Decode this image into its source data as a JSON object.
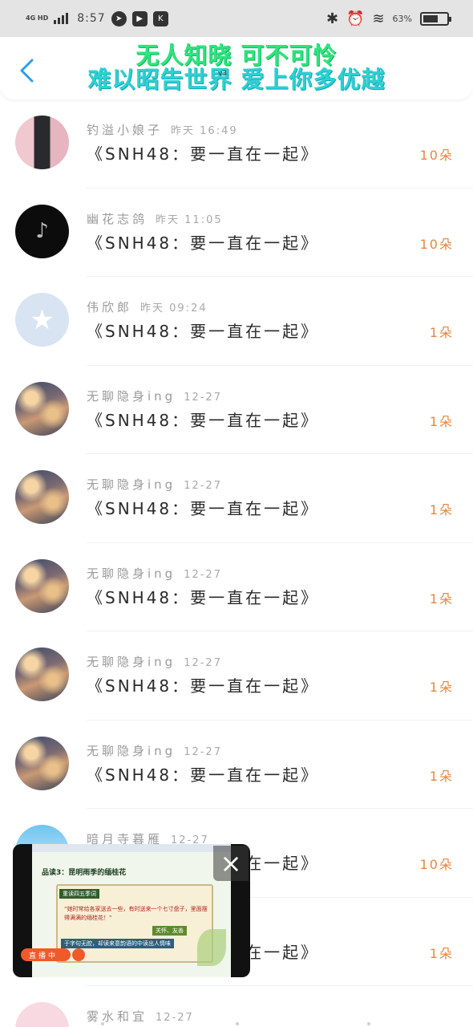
{
  "status_bar": {
    "network": "4G HD",
    "time": "8:57",
    "apps": [
      "telegram-icon",
      "play-icon",
      "k-app-icon"
    ],
    "battery_pct": "63%"
  },
  "nav": {
    "title_line1": "无人知晓 可不可怜",
    "title_line2": "难以昭告世界 爱上你多优越",
    "title_badge": "v3"
  },
  "gift_records": [
    {
      "name": "钓溢小娘子",
      "time": "昨天 16:49",
      "gift": "《SNH48：要一直在一起》",
      "count": "10朵",
      "avatar": "pink"
    },
    {
      "name": "幽花志鸽",
      "time": "昨天 11:05",
      "gift": "《SNH48：要一直在一起》",
      "count": "10朵",
      "avatar": "dark"
    },
    {
      "name": "伟欣郎",
      "time": "昨天 09:24",
      "gift": "《SNH48：要一直在一起》",
      "count": "1朵",
      "avatar": "blue"
    },
    {
      "name": "无聊隐身ing",
      "time": "12-27",
      "gift": "《SNH48：要一直在一起》",
      "count": "1朵",
      "avatar": "clouds"
    },
    {
      "name": "无聊隐身ing",
      "time": "12-27",
      "gift": "《SNH48：要一直在一起》",
      "count": "1朵",
      "avatar": "clouds"
    },
    {
      "name": "无聊隐身ing",
      "time": "12-27",
      "gift": "《SNH48：要一直在一起》",
      "count": "1朵",
      "avatar": "clouds"
    },
    {
      "name": "无聊隐身ing",
      "time": "12-27",
      "gift": "《SNH48：要一直在一起》",
      "count": "1朵",
      "avatar": "clouds"
    },
    {
      "name": "无聊隐身ing",
      "time": "12-27",
      "gift": "《SNH48：要一直在一起》",
      "count": "1朵",
      "avatar": "clouds"
    },
    {
      "name": "暗月寺暮雁",
      "time": "12-27",
      "gift": "《SNH48：要一直在一起》",
      "count": "10朵",
      "avatar": "blue2"
    },
    {
      "name": "",
      "time": "",
      "gift": "《SNH48：要一直在一起》",
      "count": "1朵",
      "avatar": "none"
    },
    {
      "name": "雾水和宜",
      "time": "12-27",
      "gift": "",
      "count": "",
      "avatar": "pinkcat"
    }
  ],
  "video": {
    "slide_title": "品读3：昆明雨季的缅桂花",
    "scroll_tag": "重读四五季词",
    "scroll_text": "“她时常给各家送去一些，有时送来一个七寸盘子，里面摆得满满的缅桂花！”",
    "green_tag": "关怀、友善",
    "blue_tag": "于字句无腔，却读来意韵语的中读出人情味",
    "live_label": "直播中",
    "close_glyph": "×"
  }
}
